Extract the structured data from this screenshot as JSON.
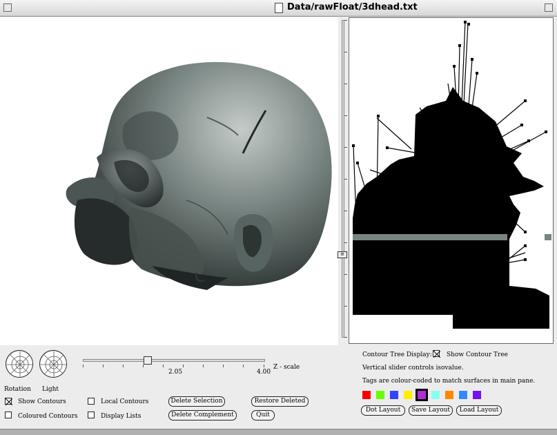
{
  "window": {
    "title": "Data/rawFloat/3dhead.txt"
  },
  "main_view": {
    "subject": "3d-head-isosurface"
  },
  "tree_view": {
    "subject": "contour-tree"
  },
  "controls": {
    "rotation_label": "Rotation",
    "light_label": "Light",
    "zscale": {
      "label": "Z - scale",
      "mid_value": "2.05",
      "max_value": "4.00",
      "current_value": 2.05
    },
    "show_contours": {
      "label": "Show Contours",
      "checked": true
    },
    "coloured_contours": {
      "label": "Coloured Contours",
      "checked": false
    },
    "local_contours": {
      "label": "Local Contours",
      "checked": false
    },
    "display_lists": {
      "label": "Display Lists",
      "checked": false
    },
    "delete_selection": "Delete Selection",
    "delete_complement": "Delete Complement",
    "restore_deleted": "Restore Deleted",
    "quit": "Quit"
  },
  "tree_panel": {
    "display_label": "Contour Tree Display:",
    "show_contour_tree": {
      "label": "Show Contour Tree",
      "checked": true
    },
    "hint_slider": "Vertical slider controls isovalue.",
    "hint_tags": "Tags are colour-coded to match surfaces in main pane.",
    "tag_colors": [
      "#ff0000",
      "#66ff00",
      "#3344ff",
      "#ffee00",
      "#b22fd6",
      "#88ffee",
      "#ff8800",
      "#3388ff",
      "#7711ee"
    ],
    "selected_tag": 4,
    "dot_layout": "Dot Layout",
    "save_layout": "Save Layout",
    "load_layout": "Load Layout"
  }
}
